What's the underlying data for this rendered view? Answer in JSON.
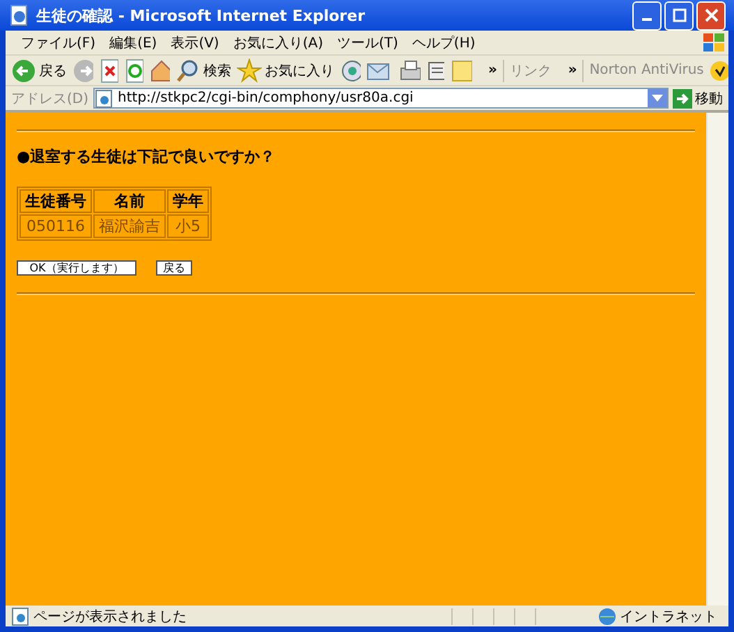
{
  "window": {
    "title": "生徒の確認 - Microsoft Internet Explorer"
  },
  "menu": [
    "ファイル(F)",
    "編集(E)",
    "表示(V)",
    "お気に入り(A)",
    "ツール(T)",
    "ヘルプ(H)"
  ],
  "toolbar": {
    "back": "戻る",
    "search": "検索",
    "favorites": "お気に入り",
    "more_1": "»",
    "links": "リンク",
    "more_2": "»",
    "norton": "Norton AntiVirus"
  },
  "address": {
    "label": "アドレス(D)",
    "url": "http://stkpc2/cgi-bin/comphony/usr80a.cgi",
    "go": "移動"
  },
  "page": {
    "question": "●退室する生徒は下記で良いですか？",
    "table": {
      "columns": [
        "生徒番号",
        "名前",
        "学年"
      ],
      "rows": [
        [
          "050116",
          "福沢諭吉",
          "小5"
        ]
      ]
    },
    "buttons": [
      "OK（実行します）",
      "戻る"
    ]
  },
  "status_bar": {
    "text": "ページが表示されました",
    "zone": "イントラネット"
  }
}
